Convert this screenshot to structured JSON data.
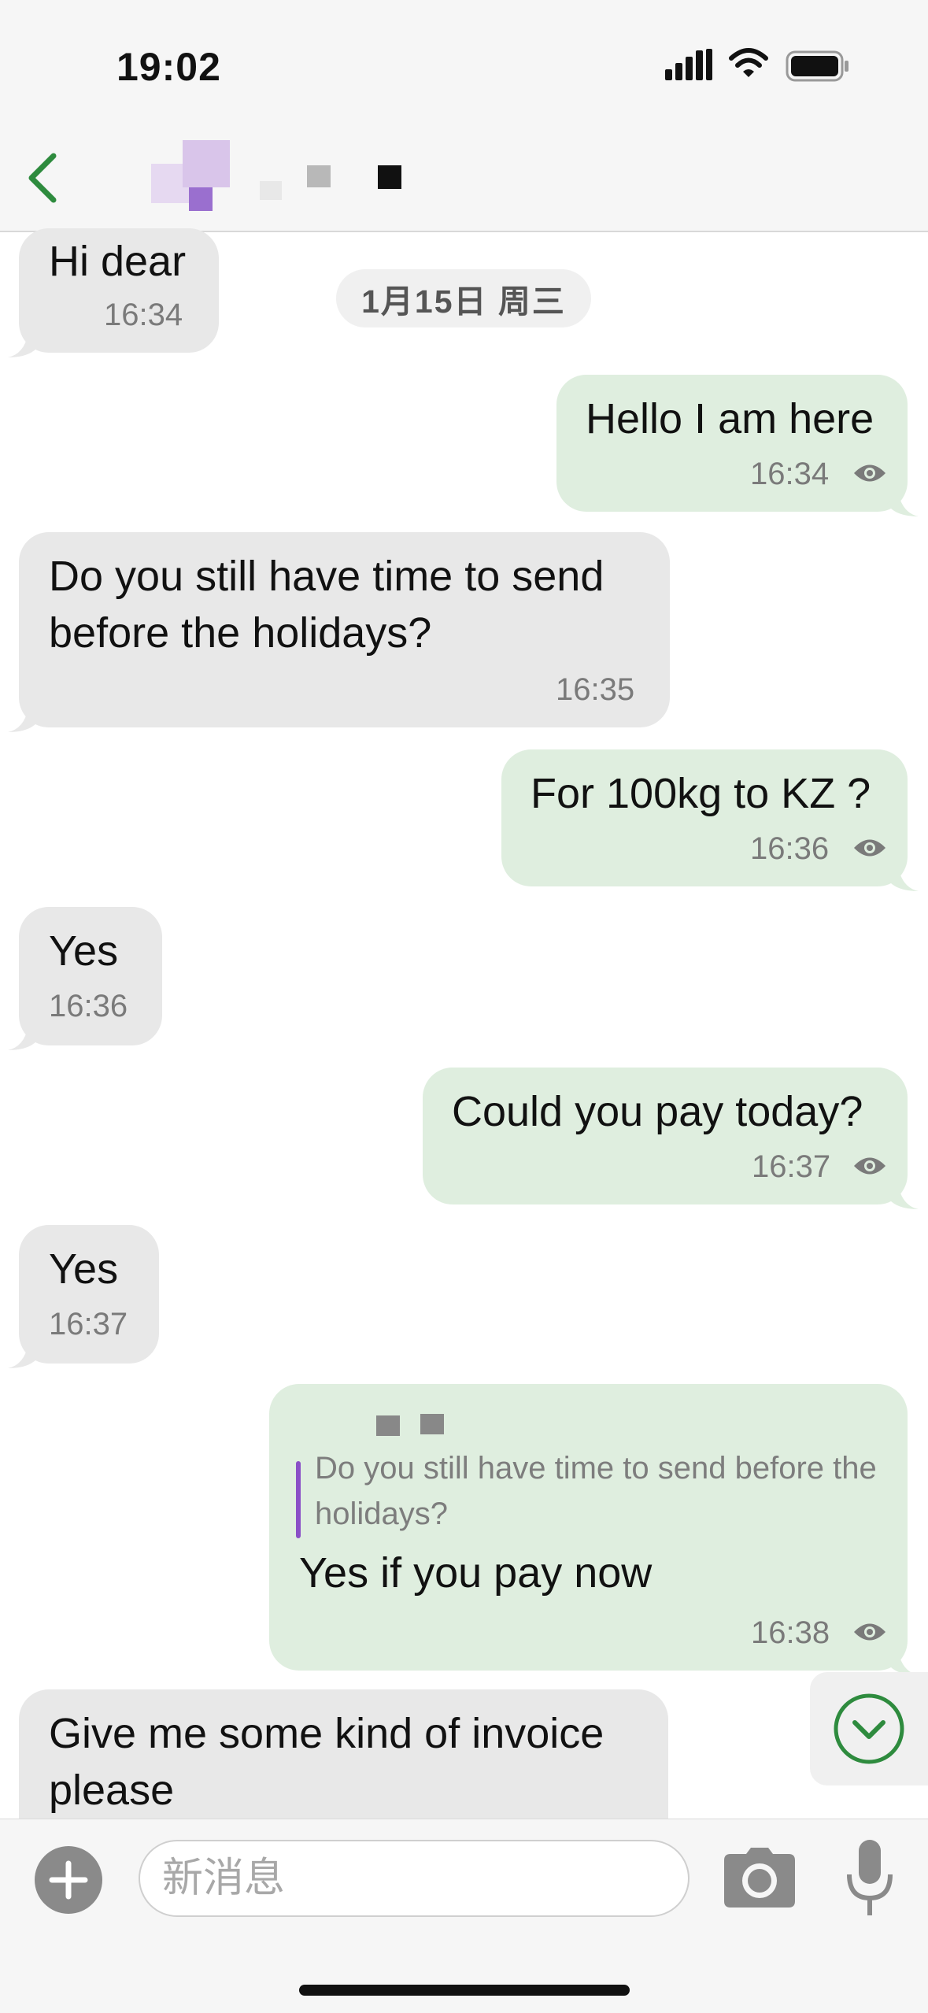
{
  "status_bar": {
    "time": "19:02"
  },
  "chat": {
    "date_divider": "1月15日 周三",
    "messages": [
      {
        "direction": "in",
        "text": "Hi dear",
        "time": "16:34"
      },
      {
        "direction": "out",
        "text": "Hello I am here",
        "time": "16:34"
      },
      {
        "direction": "in",
        "text": "Do you still have time to send\nbefore the holidays?",
        "time": "16:35"
      },
      {
        "direction": "out",
        "text": "For 100kg to KZ ?",
        "time": "16:36"
      },
      {
        "direction": "in",
        "text": "Yes",
        "time": "16:36"
      },
      {
        "direction": "out",
        "text": "Could you pay today?",
        "time": "16:37"
      },
      {
        "direction": "in",
        "text": "Yes",
        "time": "16:37"
      },
      {
        "direction": "out",
        "reply_quote": "Do you still have time to send before the holidays?",
        "text": "Yes if you pay now",
        "time": "16:38"
      },
      {
        "direction": "in",
        "text": "Give me some kind of invoice\nplease",
        "time": ""
      }
    ]
  },
  "input_bar": {
    "placeholder": "新消息"
  },
  "colors": {
    "accent": "#2e8b3e",
    "incoming": "#e8e8e8",
    "outgoing": "#dfeedf",
    "reply_bar": "#8a4fc7"
  }
}
